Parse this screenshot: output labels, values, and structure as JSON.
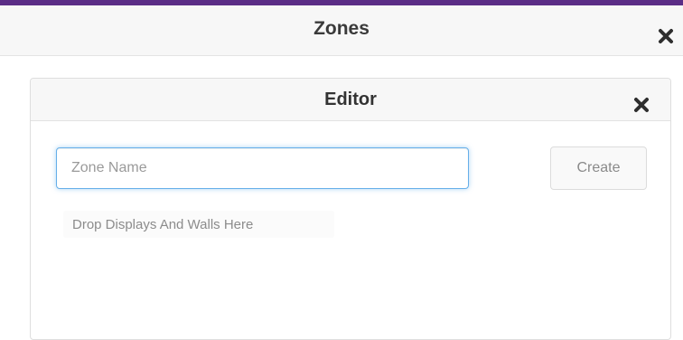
{
  "outer": {
    "title": "Zones",
    "close_icon": "close-icon",
    "accent_color": "#5b2d86"
  },
  "editor": {
    "title": "Editor",
    "close_icon": "close-icon",
    "zone_name_input": {
      "value": "",
      "placeholder": "Zone Name"
    },
    "create_label": "Create",
    "drop_zone_text": "Drop Displays And Walls Here"
  }
}
